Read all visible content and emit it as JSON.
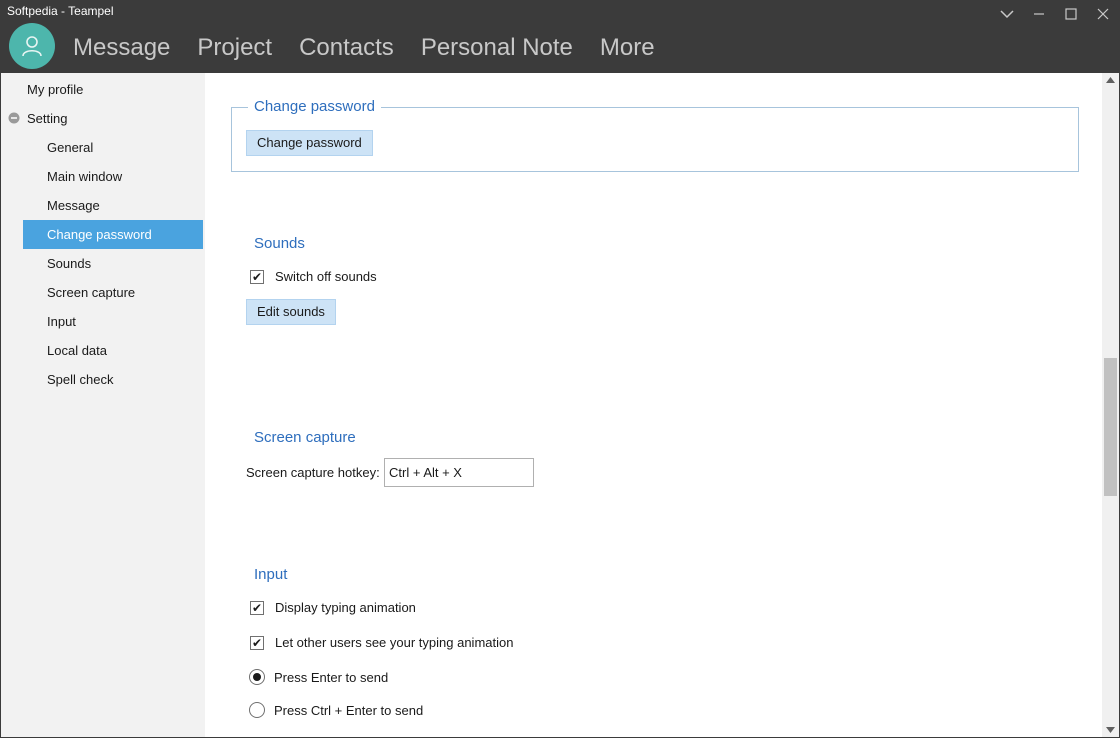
{
  "window": {
    "title": "Softpedia - Teampel",
    "controls": [
      "chevron-down",
      "minimize",
      "maximize",
      "close"
    ]
  },
  "nav": {
    "items": [
      "Message",
      "Project",
      "Contacts",
      "Personal Note",
      "More"
    ]
  },
  "sidebar": {
    "items": [
      {
        "label": "My profile",
        "level": 0
      },
      {
        "label": "Setting",
        "level": 0,
        "expanded": true
      },
      {
        "label": "General",
        "level": 1
      },
      {
        "label": "Main window",
        "level": 1
      },
      {
        "label": "Message",
        "level": 1
      },
      {
        "label": "Change password",
        "level": 1,
        "selected": true
      },
      {
        "label": "Sounds",
        "level": 1
      },
      {
        "label": "Screen capture",
        "level": 1
      },
      {
        "label": "Input",
        "level": 1
      },
      {
        "label": "Local data",
        "level": 1
      },
      {
        "label": "Spell check",
        "level": 1
      }
    ]
  },
  "change_password": {
    "title": "Change password",
    "button_label": "Change password"
  },
  "sounds": {
    "title": "Sounds",
    "switch_off_label": "Switch off sounds",
    "switch_off_checked": true,
    "edit_button_label": "Edit sounds"
  },
  "screen_capture": {
    "title": "Screen capture",
    "hotkey_label": "Screen capture hotkey:",
    "hotkey_value": "Ctrl + Alt + X"
  },
  "input": {
    "title": "Input",
    "display_typing_label": "Display typing animation",
    "display_typing_checked": true,
    "others_see_typing_label": "Let other users see your typing animation",
    "others_see_typing_checked": true,
    "enter_to_send_label": "Press Enter to send",
    "ctrl_enter_to_send_label": "Press Ctrl + Enter to send",
    "send_mode": "enter"
  },
  "colors": {
    "titlebar_bg": "#3b3b3b",
    "avatar": "#4db6ac",
    "selection": "#4aa3df",
    "section_title": "#2e6ebd",
    "button_bg": "#cde3f6"
  }
}
